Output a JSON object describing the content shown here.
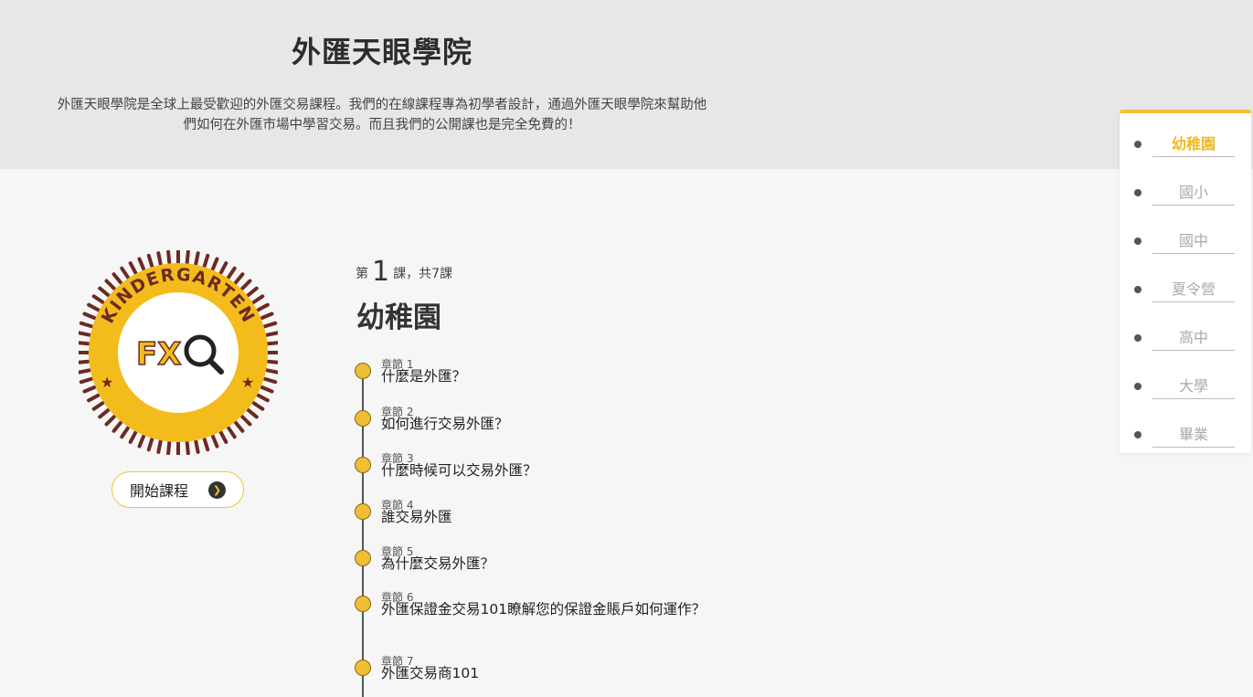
{
  "header": {
    "title": "外匯天眼學院",
    "description": "外匯天眼學院是全球上最受歡迎的外匯交易課程。我們的在線課程專為初學者設計，通過外匯天眼學院來幫助他們如何在外匯市場中學習交易。而且我們的公開課也是完全免費的！"
  },
  "badge": {
    "top_text": "KINDERGARTEN",
    "logo_text": "FX",
    "colors": {
      "ring": "#6b2a22",
      "fill": "#f3bc1c",
      "center": "#ffffff"
    },
    "icon": "magnifier-icon"
  },
  "start_button": {
    "label": "開始課程",
    "icon": "chevron-right-icon"
  },
  "lesson": {
    "prefix": "第",
    "number": "1",
    "suffix": "課，共7課",
    "title": "幼稚園"
  },
  "chapters": [
    {
      "num": "章節 1",
      "name": "什麼是外匯？"
    },
    {
      "num": "章節 2",
      "name": "如何進行交易外匯？"
    },
    {
      "num": "章節 3",
      "name": "什麼時候可以交易外匯？"
    },
    {
      "num": "章節 4",
      "name": "誰交易外匯"
    },
    {
      "num": "章節 5",
      "name": "為什麼交易外匯？"
    },
    {
      "num": "章節 6",
      "name": "外匯保證金交易101瞭解您的保證金賬戶如何運作？"
    },
    {
      "num": "章節 7",
      "name": "外匯交易商101"
    }
  ],
  "sidenav": {
    "accent_color": "#f3c23a",
    "items": [
      {
        "label": "幼稚園",
        "active": true
      },
      {
        "label": "國小"
      },
      {
        "label": "國中"
      },
      {
        "label": "夏令營"
      },
      {
        "label": "高中"
      },
      {
        "label": "大學"
      },
      {
        "label": "畢業"
      }
    ]
  }
}
